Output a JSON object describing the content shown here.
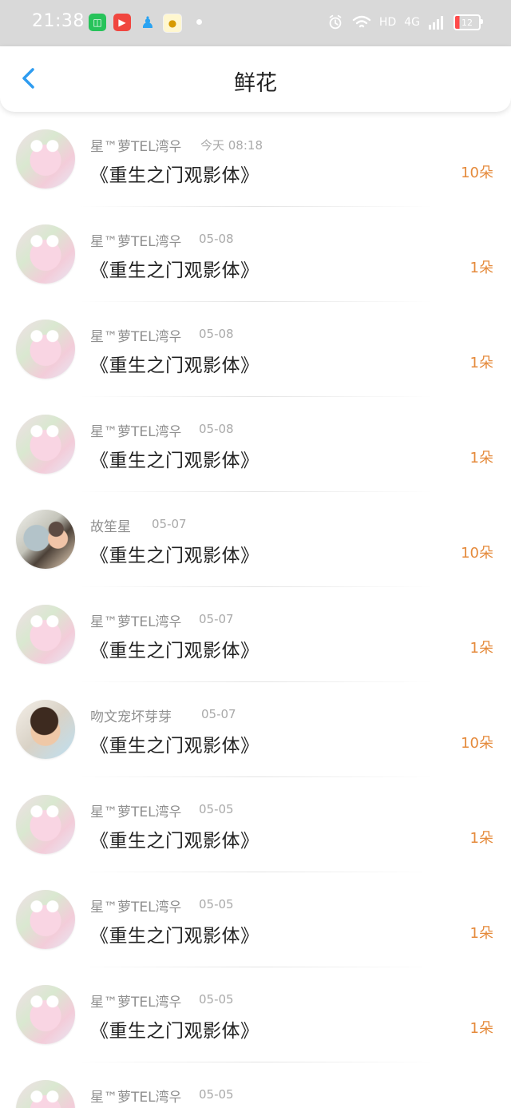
{
  "status_bar": {
    "time": "21:38",
    "network": "4G",
    "hd": "HD",
    "battery": "12"
  },
  "header": {
    "title": "鲜花"
  },
  "items": [
    {
      "name": "星™萝TEL湾우",
      "date": "今天 08:18",
      "title": "《重生之门观影体》",
      "count": "10朵",
      "avatar": "pig"
    },
    {
      "name": "星™萝TEL湾우",
      "date": "05-08",
      "title": "《重生之门观影体》",
      "count": "1朵",
      "avatar": "pig"
    },
    {
      "name": "星™萝TEL湾우",
      "date": "05-08",
      "title": "《重生之门观影体》",
      "count": "1朵",
      "avatar": "pig"
    },
    {
      "name": "星™萝TEL湾우",
      "date": "05-08",
      "title": "《重生之门观影体》",
      "count": "1朵",
      "avatar": "pig"
    },
    {
      "name": "故笙星",
      "date": "05-07",
      "title": "《重生之门观影体》",
      "count": "10朵",
      "avatar": "dark"
    },
    {
      "name": "星™萝TEL湾우",
      "date": "05-07",
      "title": "《重生之门观影体》",
      "count": "1朵",
      "avatar": "pig"
    },
    {
      "name": "吻文宠坏芽芽",
      "date": "05-07",
      "title": "《重生之门观影体》",
      "count": "10朵",
      "avatar": "smile"
    },
    {
      "name": "星™萝TEL湾우",
      "date": "05-05",
      "title": "《重生之门观影体》",
      "count": "1朵",
      "avatar": "pig"
    },
    {
      "name": "星™萝TEL湾우",
      "date": "05-05",
      "title": "《重生之门观影体》",
      "count": "1朵",
      "avatar": "pig"
    },
    {
      "name": "星™萝TEL湾우",
      "date": "05-05",
      "title": "《重生之门观影体》",
      "count": "1朵",
      "avatar": "pig"
    },
    {
      "name": "星™萝TEL湾우",
      "date": "05-05",
      "title": "",
      "count": "",
      "avatar": "pig"
    }
  ],
  "icons": {
    "back": "chevron-left-icon",
    "alarm": "alarm-icon",
    "wifi": "wifi-icon",
    "signal": "signal-icon",
    "battery": "battery-icon"
  },
  "colors": {
    "status_bar_bg": "#d9d9d9",
    "accent_blue": "#2e9cf0",
    "flower_orange": "#e58a3b"
  }
}
